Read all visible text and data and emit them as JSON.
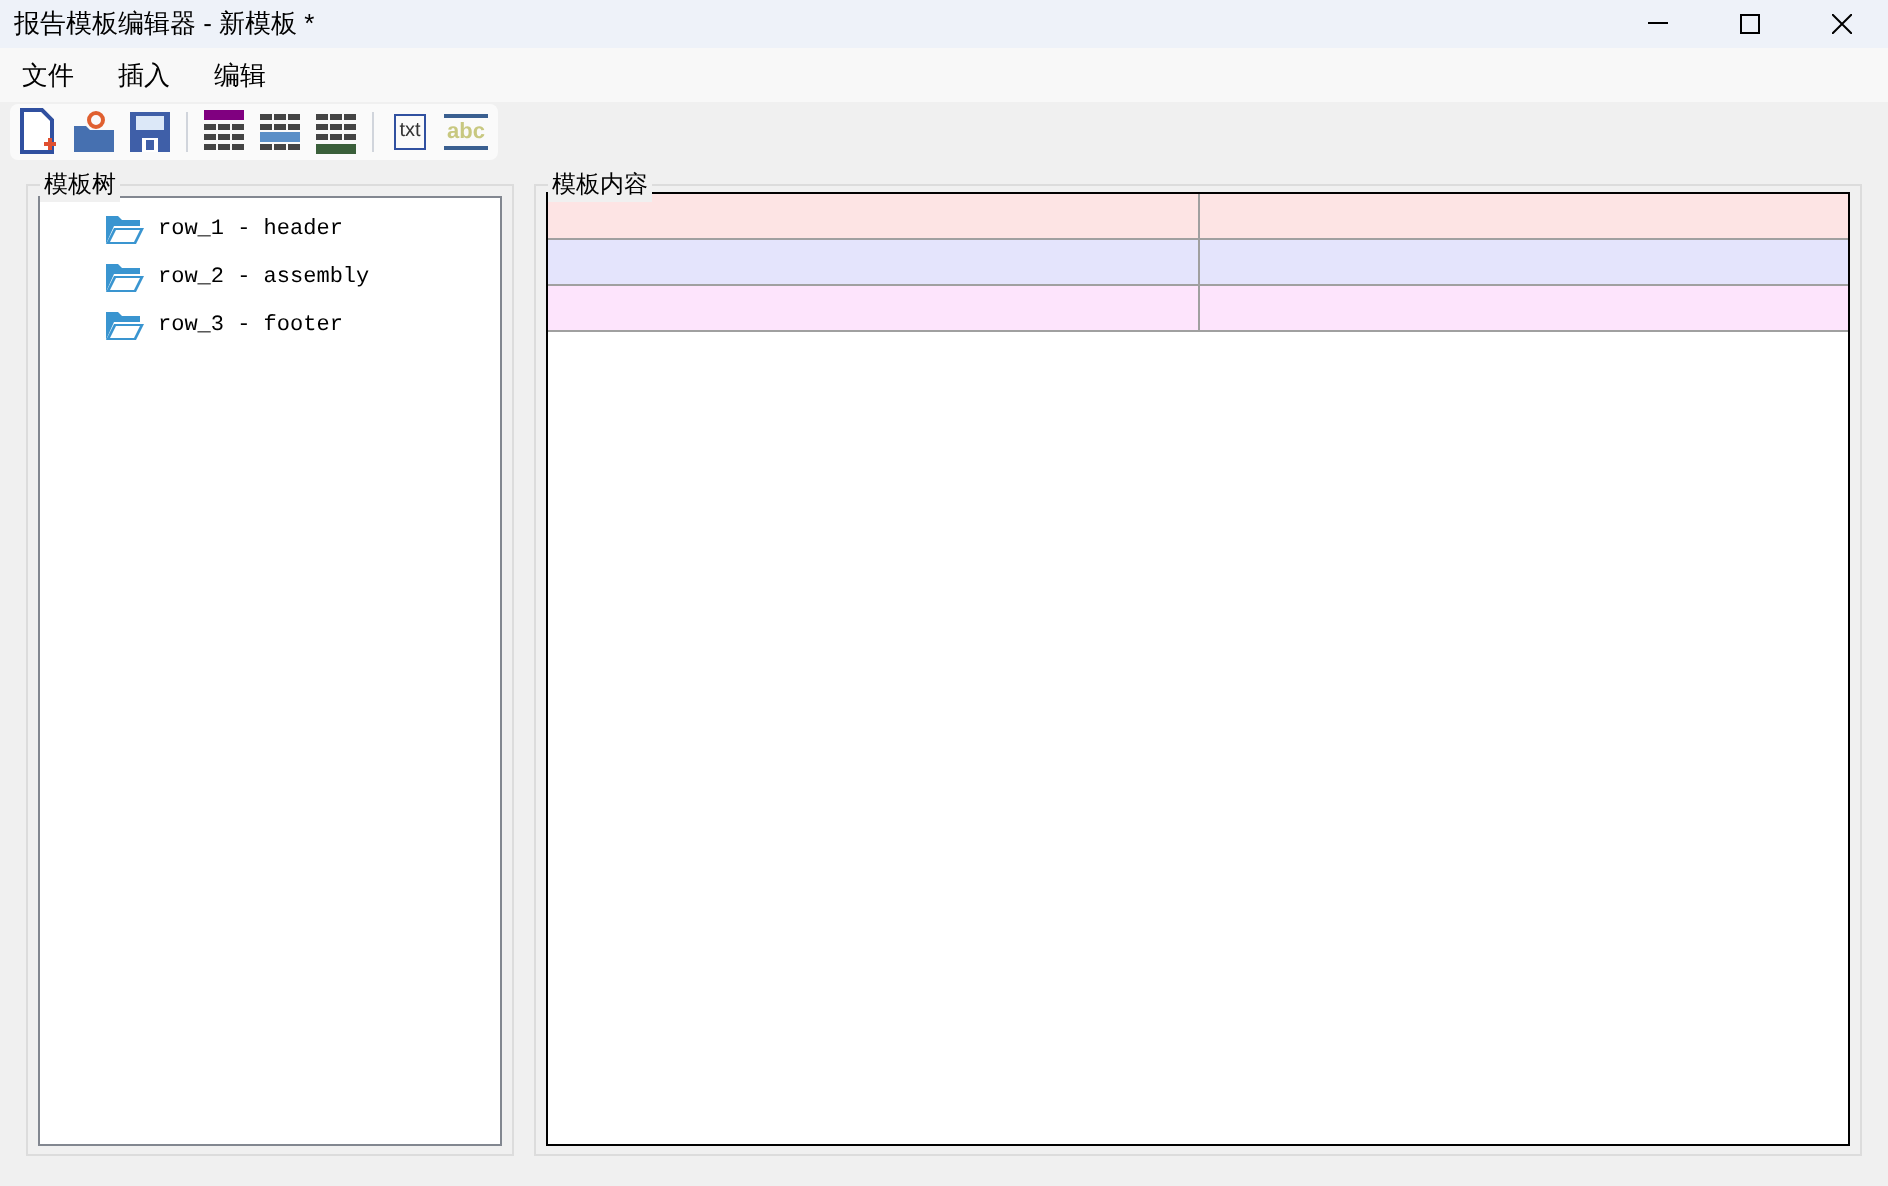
{
  "window": {
    "title": "报告模板编辑器 - 新模板 *"
  },
  "menu": [
    "文件",
    "插入",
    "编辑"
  ],
  "toolbar": [
    {
      "kind": "new"
    },
    {
      "kind": "open"
    },
    {
      "kind": "save"
    },
    {
      "kind": "sep"
    },
    {
      "kind": "table_top",
      "color": "#800080"
    },
    {
      "kind": "table_middle",
      "color": "#5b8fc7"
    },
    {
      "kind": "table_bottom",
      "color": "#3a5f3a"
    },
    {
      "kind": "sep"
    },
    {
      "kind": "txt",
      "label": "txt"
    },
    {
      "kind": "abc",
      "label": "abc"
    }
  ],
  "tree": {
    "title": "模板树",
    "items": [
      {
        "label": "row_1 - header"
      },
      {
        "label": "row_2 - assembly"
      },
      {
        "label": "row_3 - footer"
      }
    ]
  },
  "content": {
    "title": "模板内容",
    "rows": [
      {
        "color": "#fde4e4"
      },
      {
        "color": "#e4e4fc"
      },
      {
        "color": "#fde4fc"
      }
    ]
  }
}
